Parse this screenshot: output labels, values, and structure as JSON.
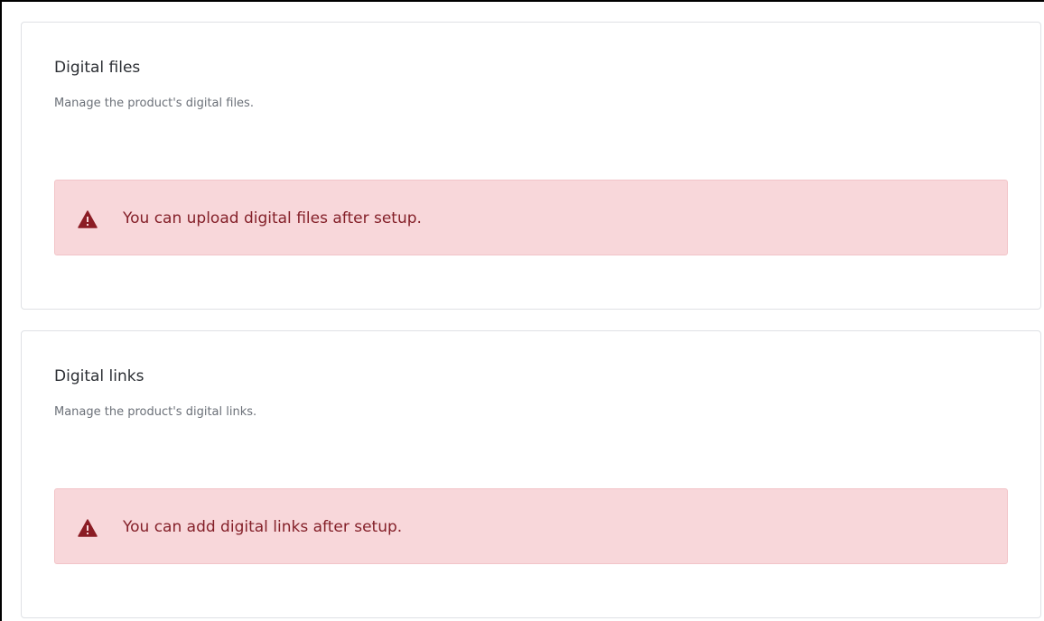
{
  "sections": [
    {
      "title": "Digital files",
      "subtitle": "Manage the product's digital files.",
      "alert": {
        "icon": "warning-triangle-icon",
        "message": "You can upload digital files after setup."
      }
    },
    {
      "title": "Digital links",
      "subtitle": "Manage the product's digital links.",
      "alert": {
        "icon": "warning-triangle-icon",
        "message": "You can add digital links after setup."
      }
    }
  ],
  "colors": {
    "alert_background": "#f8d7da",
    "alert_border": "#f2c4c8",
    "alert_text": "#842029",
    "alert_icon": "#8b1c24",
    "card_border": "#dfe1e5"
  }
}
